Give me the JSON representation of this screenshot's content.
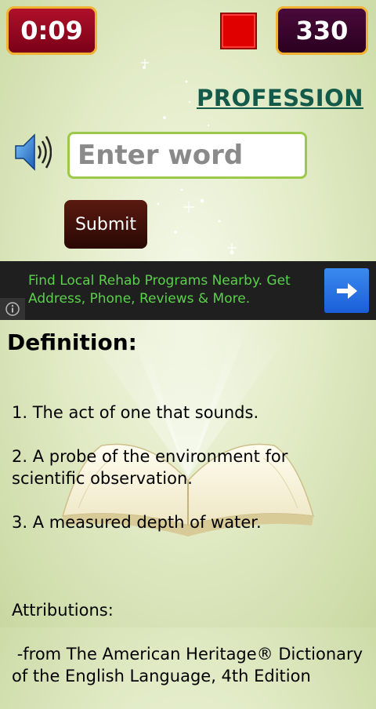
{
  "timer": "0:09",
  "score": "330",
  "category": "PROFESSION",
  "input": {
    "placeholder": "Enter word",
    "value": ""
  },
  "submit_label": "Submit",
  "ad": {
    "text": "Find Local Rehab Programs Nearby. Get Address, Phone, Reviews & More.",
    "arrow_icon": "arrow-right-icon",
    "info_icon": "info-icon"
  },
  "definition": {
    "heading": "Definition:",
    "lines": [
      "1. The act of one that sounds.",
      "2. A probe of the environment for scientific observation.",
      "3. A measured depth of water.",
      "",
      "Attributions:",
      " -from The American Heritage® Dictionary of the English Language, 4th Edition"
    ]
  },
  "colors": {
    "timer_bg": "#9a0020",
    "score_bg": "#3a0a2e",
    "box_border": "#f2b233",
    "stop": "#e00000",
    "category": "#145a4a",
    "input_border": "#9cc94a",
    "ad_text": "#5ad14a",
    "ad_button": "#1a6ee8"
  }
}
